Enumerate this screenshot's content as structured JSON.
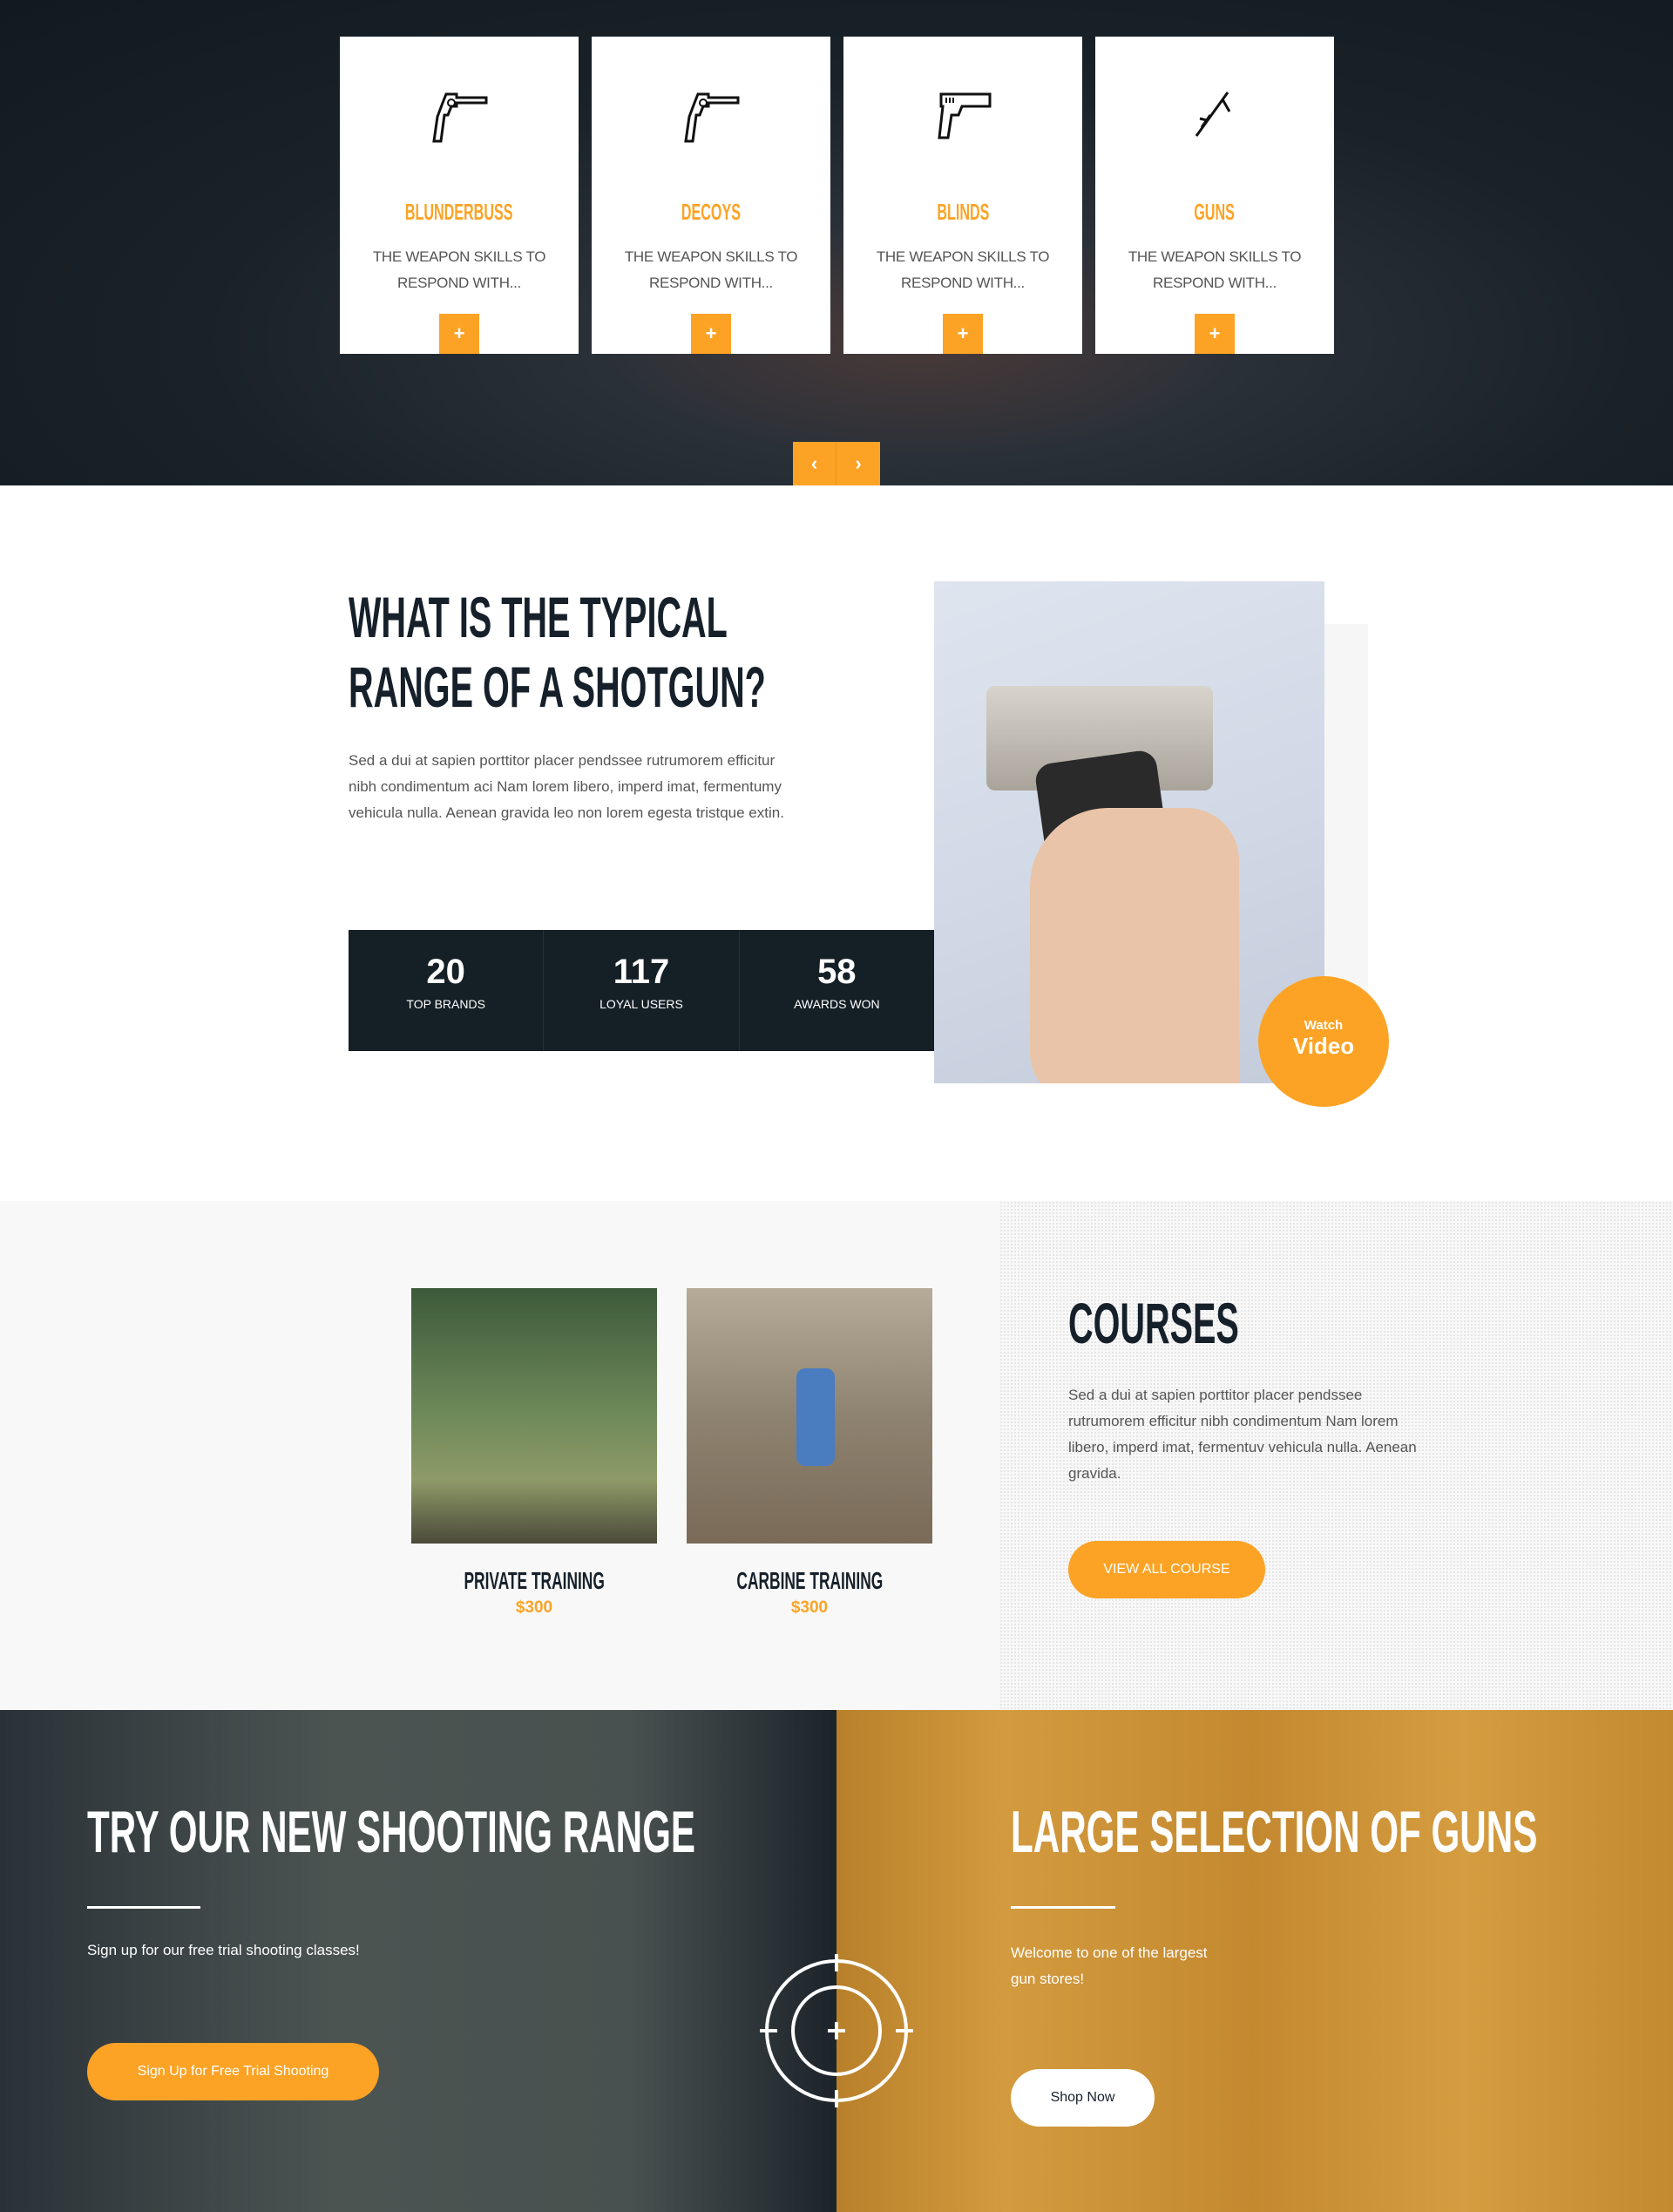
{
  "services": {
    "cards": [
      {
        "icon": "revolver-icon",
        "title": "BLUNDERBUSS",
        "desc": "THE WEAPON SKILLS TO RESPOND WITH...",
        "button": "+"
      },
      {
        "icon": "revolver-icon",
        "title": "DECOYS",
        "desc": "THE WEAPON SKILLS TO RESPOND WITH...",
        "button": "+"
      },
      {
        "icon": "pistol-icon",
        "title": "BLINDS",
        "desc": "THE WEAPON SKILLS TO RESPOND WITH...",
        "button": "+"
      },
      {
        "icon": "rifle-icon",
        "title": "GUNS",
        "desc": "THE WEAPON SKILLS TO RESPOND WITH...",
        "button": "+"
      }
    ],
    "prev": "‹",
    "next": "›"
  },
  "about": {
    "title_line1": "WHAT IS THE TYPICAL",
    "title_line2": "RANGE OF A SHOTGUN?",
    "text": "Sed a dui at sapien porttitor placer pendssee rutrumorem efficitur nibh condimentum aci Nam lorem libero, imperd imat, fermentumy vehicula nulla. Aenean gravida leo non lorem egesta tristque extin.",
    "stats": [
      {
        "value": "20",
        "label": "TOP BRANDS"
      },
      {
        "value": "117",
        "label": "LOYAL USERS"
      },
      {
        "value": "58",
        "label": "AWARDS WON"
      }
    ],
    "watch_small": "Watch",
    "watch_big": "Video"
  },
  "courses": {
    "items": [
      {
        "title": "PRIVATE TRAINING",
        "price": "$300"
      },
      {
        "title": "CARBINE TRAINING",
        "price": "$300"
      }
    ],
    "heading": "COURSES",
    "text": "Sed a dui at sapien porttitor placer pendssee rutrumorem efficitur nibh condimentum Nam lorem libero, imperd imat, fermentuv vehicula nulla. Aenean gravida.",
    "button": "VIEW ALL COURSE"
  },
  "promo": {
    "left": {
      "title": "TRY OUR NEW SHOOTING RANGE",
      "text": "Sign up for our free trial shooting classes!",
      "button": "Sign Up for Free Trial Shooting"
    },
    "right": {
      "title": "LARGE SELECTION OF GUNS",
      "text_line1": "Welcome to one of the largest",
      "text_line2": "gun stores!",
      "button": "Shop Now"
    }
  },
  "colors": {
    "accent": "#fca326",
    "dark": "#151f26"
  }
}
